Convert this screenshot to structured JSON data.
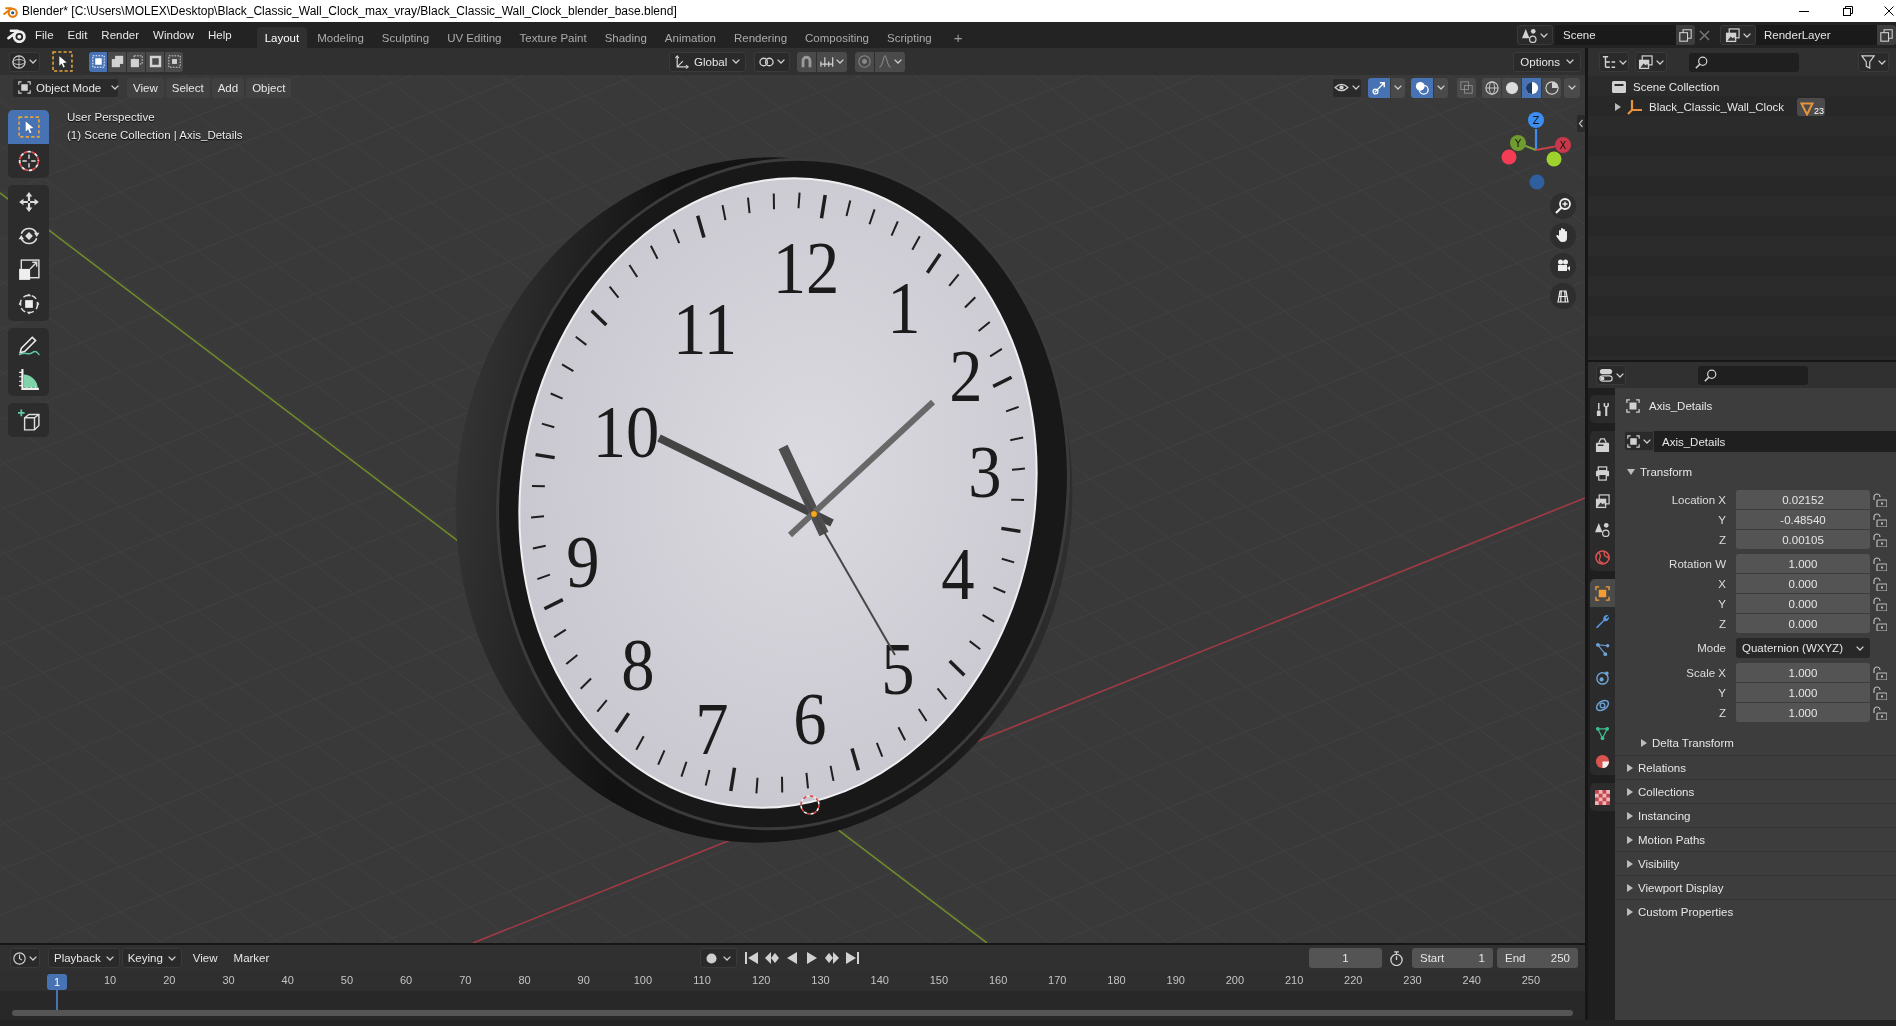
{
  "window": {
    "title": "Blender* [C:\\Users\\MOLEX\\Desktop\\Black_Classic_Wall_Clock_max_vray/Black_Classic_Wall_Clock_blender_base.blend]"
  },
  "topbar": {
    "menus": [
      "File",
      "Edit",
      "Render",
      "Window",
      "Help"
    ],
    "workspaces": [
      {
        "label": "Layout",
        "selected": true
      },
      {
        "label": "Modeling",
        "selected": false
      },
      {
        "label": "Sculpting",
        "selected": false
      },
      {
        "label": "UV Editing",
        "selected": false
      },
      {
        "label": "Texture Paint",
        "selected": false
      },
      {
        "label": "Shading",
        "selected": false
      },
      {
        "label": "Animation",
        "selected": false
      },
      {
        "label": "Rendering",
        "selected": false
      },
      {
        "label": "Compositing",
        "selected": false
      },
      {
        "label": "Scripting",
        "selected": false
      }
    ],
    "add_workspace": "+",
    "scene": "Scene",
    "view_layer": "RenderLayer"
  },
  "tool_settings": {
    "select_modes": [
      {
        "selected": true
      },
      {
        "selected": false
      },
      {
        "selected": false
      },
      {
        "selected": false
      },
      {
        "selected": false
      }
    ],
    "orientation": "Global",
    "snap": false,
    "proportional": false,
    "options": "Options"
  },
  "viewport": {
    "mode": "Object Mode",
    "menus": [
      "View",
      "Select",
      "Add",
      "Object"
    ],
    "gizmos": true,
    "overlays": true,
    "xray": false,
    "shading": [
      {
        "kind": "wireframe",
        "selected": false
      },
      {
        "kind": "solid",
        "selected": false
      },
      {
        "kind": "material",
        "selected": true
      },
      {
        "kind": "rendered",
        "selected": false
      }
    ],
    "info": [
      "User Perspective",
      "(1) Scene Collection | Axis_Details"
    ],
    "tools": [
      {
        "kind": "select",
        "selected": true
      },
      {
        "kind": "cursor",
        "selected": false
      },
      {
        "kind": "move",
        "selected": false
      },
      {
        "kind": "rotate",
        "selected": false
      },
      {
        "kind": "scale",
        "selected": false
      },
      {
        "kind": "transform",
        "selected": false
      },
      {
        "kind": "annotate",
        "selected": false
      },
      {
        "kind": "measure",
        "selected": false
      },
      {
        "kind": "add_cube",
        "selected": false
      }
    ],
    "axes": [
      "Z",
      "Y",
      "X"
    ],
    "clock_numerals": [
      "12",
      "1",
      "2",
      "3",
      "4",
      "5",
      "6",
      "7",
      "8",
      "9",
      "10",
      "11"
    ]
  },
  "outliner": {
    "items": [
      {
        "label": "Scene Collection",
        "kind": "collection",
        "children": [
          {
            "label": "Black_Classic_Wall_Clock",
            "kind": "empty",
            "expanded": false,
            "count": "23"
          }
        ]
      }
    ]
  },
  "properties": {
    "tabs": [
      {
        "kind": "tool",
        "selected": false
      },
      {
        "kind": "render",
        "selected": false
      },
      {
        "kind": "output",
        "selected": false
      },
      {
        "kind": "view_layer",
        "selected": false
      },
      {
        "kind": "scene",
        "selected": false
      },
      {
        "kind": "world",
        "selected": false
      },
      {
        "kind": "object",
        "selected": true
      },
      {
        "kind": "modifiers",
        "selected": false
      },
      {
        "kind": "particles",
        "selected": false
      },
      {
        "kind": "physics",
        "selected": false
      },
      {
        "kind": "constraints",
        "selected": false
      },
      {
        "kind": "data",
        "selected": false
      },
      {
        "kind": "material",
        "selected": false
      },
      {
        "kind": "texture",
        "selected": false
      }
    ],
    "object_name": "Axis_Details",
    "datablock": "Axis_Details",
    "transform": {
      "title": "Transform",
      "expanded": true,
      "groups": [
        [
          {
            "label": "Location X",
            "value": "0.02152",
            "kind": "number",
            "locked": false
          },
          {
            "label": "Y",
            "value": "-0.48540",
            "kind": "number",
            "locked": false
          },
          {
            "label": "Z",
            "value": "0.00105",
            "kind": "number",
            "locked": false
          }
        ],
        [
          {
            "label": "Rotation W",
            "value": "1.000",
            "kind": "number",
            "locked": false
          },
          {
            "label": "X",
            "value": "0.000",
            "kind": "number",
            "locked": false
          },
          {
            "label": "Y",
            "value": "0.000",
            "kind": "number",
            "locked": false
          },
          {
            "label": "Z",
            "value": "0.000",
            "kind": "number",
            "locked": false
          }
        ],
        [
          {
            "label": "Mode",
            "value": "Quaternion (WXYZ)",
            "kind": "dropdown"
          }
        ],
        [
          {
            "label": "Scale X",
            "value": "1.000",
            "kind": "number",
            "locked": false
          },
          {
            "label": "Y",
            "value": "1.000",
            "kind": "number",
            "locked": false
          },
          {
            "label": "Z",
            "value": "1.000",
            "kind": "number",
            "locked": false
          }
        ]
      ]
    },
    "subpanels": [
      {
        "label": "Delta Transform",
        "expanded": false
      }
    ],
    "panels": [
      {
        "label": "Relations",
        "expanded": false
      },
      {
        "label": "Collections",
        "expanded": false
      },
      {
        "label": "Instancing",
        "expanded": false
      },
      {
        "label": "Motion Paths",
        "expanded": false
      },
      {
        "label": "Visibility",
        "expanded": false
      },
      {
        "label": "Viewport Display",
        "expanded": false
      },
      {
        "label": "Custom Properties",
        "expanded": false
      }
    ]
  },
  "timeline": {
    "menus": [
      {
        "label": "Playback",
        "dropdown": true
      },
      {
        "label": "Keying",
        "dropdown": true
      },
      {
        "label": "View",
        "dropdown": false
      },
      {
        "label": "Marker",
        "dropdown": false
      }
    ],
    "auto_key": false,
    "controls": [
      {
        "kind": "jump_start"
      },
      {
        "kind": "prev_key"
      },
      {
        "kind": "play_reverse"
      },
      {
        "kind": "play"
      },
      {
        "kind": "next_key"
      },
      {
        "kind": "jump_end"
      }
    ],
    "frame": "1",
    "start_label": "Start",
    "start": "1",
    "end_label": "End",
    "end": "250",
    "playhead": "1",
    "ticks": [
      "10",
      "20",
      "30",
      "40",
      "50",
      "60",
      "70",
      "80",
      "90",
      "100",
      "110",
      "120",
      "130",
      "140",
      "150",
      "160",
      "170",
      "180",
      "190",
      "200",
      "210",
      "220",
      "230",
      "240",
      "250"
    ]
  }
}
